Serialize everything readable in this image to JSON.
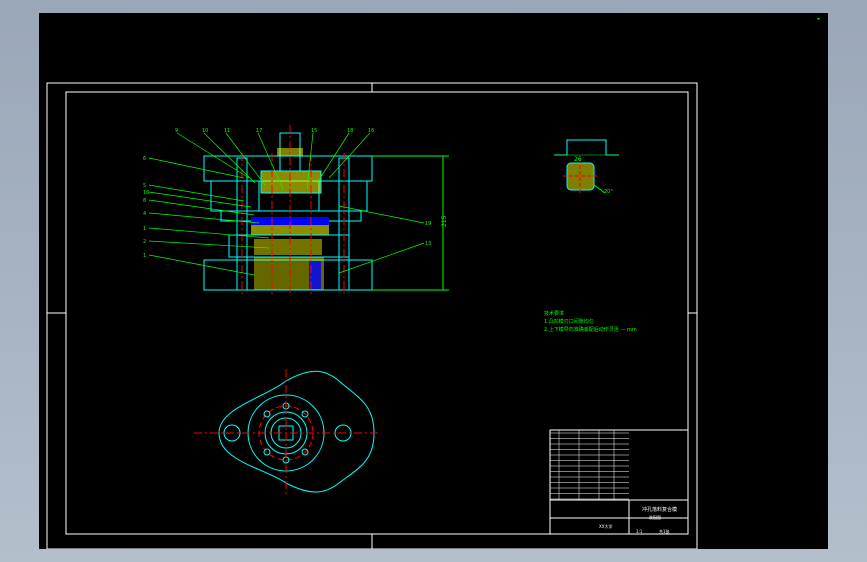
{
  "viewport": {
    "marker": "◂"
  },
  "drawing": {
    "colors": {
      "background": "#000000",
      "sheet": "#ffffff",
      "part": "#00ffff",
      "leader": "#00ff00",
      "centerline": "#ff0000",
      "section_fill": "#ffff00",
      "insert_fill": "#0000ff"
    },
    "callouts_top": [
      "9",
      "10",
      "11",
      "17",
      "15",
      "18",
      "16"
    ],
    "callouts_left": [
      "6",
      "5",
      "16",
      "8",
      "4",
      "1",
      "2",
      "1"
    ],
    "callouts_right": [
      "19",
      "13"
    ],
    "dimension_height": "215",
    "part_dims": {
      "width": "26",
      "angle": "20°",
      "flange": "10"
    },
    "notes": [
      "技术要求",
      "1.凸凹模刃口间隙均匀",
      "2.上下模导向准确装配后动作灵活 — mm"
    ]
  },
  "title_block": {
    "drawing_title": "冲孔落料复合模",
    "subtitle": "装配图",
    "school": "XX大学",
    "scale": "1:1",
    "sheet": "共1张"
  }
}
